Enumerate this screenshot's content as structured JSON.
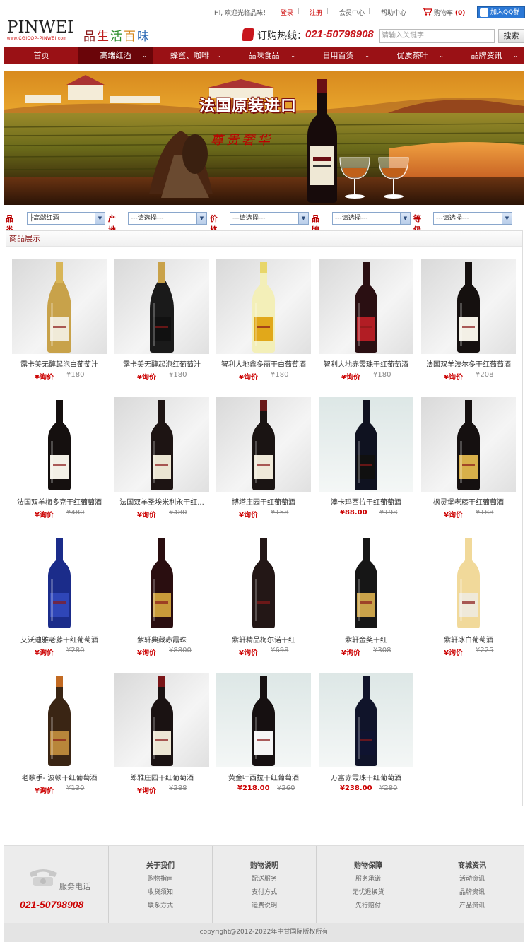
{
  "top_bar": {
    "greeting": "Hi, 欢迎光临品味！",
    "login": "登录",
    "register": "注册",
    "member_center": "会员中心",
    "help_center": "帮助中心",
    "cart_label": "购物车",
    "cart_count": "(0)",
    "qq_join": "加入QQ群"
  },
  "header": {
    "logo_text": "PINWEI",
    "logo_url_text": "www.CGICOP-PINWEI.com",
    "slogan": [
      "品",
      "生",
      "活",
      "百",
      "味"
    ],
    "hotline_label": "订购热线：",
    "hotline_number": "021-50798908",
    "search_placeholder": "请输入关键字",
    "search_button": "搜索"
  },
  "nav": {
    "items": [
      {
        "label": "首页",
        "has_menu": false
      },
      {
        "label": "高端红酒",
        "has_menu": true
      },
      {
        "label": "蜂蜜、咖啡",
        "has_menu": true
      },
      {
        "label": "品味食品",
        "has_menu": true
      },
      {
        "label": "日用百货",
        "has_menu": true
      },
      {
        "label": "优质茶叶",
        "has_menu": true
      },
      {
        "label": "品牌资讯",
        "has_menu": true
      }
    ]
  },
  "banner": {
    "title": "法国原装进口",
    "subtitle": "尊贵奢华"
  },
  "filters": [
    {
      "label": "品类",
      "value": "├高端红酒"
    },
    {
      "label": "产地",
      "value": "---请选择---"
    },
    {
      "label": "价格",
      "value": "---请选择---"
    },
    {
      "label": "品牌",
      "value": "---请选择---"
    },
    {
      "label": "等级",
      "value": "---请选择---"
    }
  ],
  "products_section": {
    "title": "商品展示",
    "items": [
      {
        "name": "露卡美无醇起泡白葡萄汁",
        "price": "¥询价",
        "old_price": "¥180",
        "bottle": "#c8a24a",
        "neck": "#d8b557",
        "label": "#f0ead8",
        "bg": "grey"
      },
      {
        "name": "露卡美无醇起泡红葡萄汁",
        "price": "¥询价",
        "old_price": "¥180",
        "bottle": "#1a1a1a",
        "neck": "#c9a24a",
        "label": "#111",
        "bg": "grey"
      },
      {
        "name": "智利大地鑫多丽干白葡萄酒",
        "price": "¥询价",
        "old_price": "¥180",
        "bottle": "#f3efb8",
        "neck": "#e8d66a",
        "label": "#e1a81a",
        "bg": "grey"
      },
      {
        "name": "智利大地赤霞珠干红葡萄酒",
        "price": "¥询价",
        "old_price": "¥180",
        "bottle": "#2a0f12",
        "neck": "#2a0f12",
        "label": "#b21d24",
        "bg": "grey"
      },
      {
        "name": "法国双羊波尔多干红葡萄酒",
        "price": "¥询价",
        "old_price": "¥208",
        "bottle": "#15100f",
        "neck": "#15100f",
        "label": "#f3f0e6",
        "bg": "grey"
      },
      {
        "name": "法国双羊梅多克干红葡萄酒",
        "price": "¥询价",
        "old_price": "¥480",
        "bottle": "#15100f",
        "neck": "#15100f",
        "label": "#f3f0e6",
        "bg": "white"
      },
      {
        "name": "法国双羊圣埃米利永干红...",
        "price": "¥询价",
        "old_price": "¥480",
        "bottle": "#1d1413",
        "neck": "#1d1413",
        "label": "#ebe5d2",
        "bg": "grey"
      },
      {
        "name": "博塔庄园干红葡萄酒",
        "price": "¥询价",
        "old_price": "¥158",
        "bottle": "#1a1413",
        "neck": "#6b1a1a",
        "label": "#efe9d9",
        "bg": "grey"
      },
      {
        "name": "澳卡玛西拉干红葡萄酒",
        "price": "¥88.00",
        "old_price": "¥198",
        "bottle": "#0f1220",
        "neck": "#0f1220",
        "label": "#101010",
        "bg": "sky"
      },
      {
        "name": "枫灵堡老藤干红葡萄酒",
        "price": "¥询价",
        "old_price": "¥188",
        "bottle": "#151010",
        "neck": "#151010",
        "label": "#d8b04a",
        "bg": "grey"
      },
      {
        "name": "艾沃迪雅老藤干红葡萄酒",
        "price": "¥询价",
        "old_price": "¥280",
        "bottle": "#1b2c8a",
        "neck": "#1b2c8a",
        "label": "#2f46b8",
        "bg": "white"
      },
      {
        "name": "紫轩典藏赤霞珠",
        "price": "¥询价",
        "old_price": "¥8800",
        "bottle": "#2a0e10",
        "neck": "#2a0e10",
        "label": "#c89a3a",
        "bg": "white"
      },
      {
        "name": "紫轩精品梅尔诺干红",
        "price": "¥询价",
        "old_price": "¥698",
        "bottle": "#231716",
        "neck": "#231716",
        "label": "#231716",
        "bg": "white"
      },
      {
        "name": "紫轩金奖干红",
        "price": "¥询价",
        "old_price": "¥308",
        "bottle": "#161616",
        "neck": "#161616",
        "label": "#c9a24a",
        "bg": "white"
      },
      {
        "name": "紫轩冰白葡萄酒",
        "price": "¥询价",
        "old_price": "¥225",
        "bottle": "#f1d99a",
        "neck": "#f1d99a",
        "label": "#efe9d9",
        "bg": "white"
      },
      {
        "name": "老歌手- 波顿干红葡萄酒",
        "price": "¥询价",
        "old_price": "¥130",
        "bottle": "#3a2514",
        "neck": "#c26a22",
        "label": "#b8863a",
        "bg": "white"
      },
      {
        "name": "郎雅庄园干红葡萄酒",
        "price": "¥询价",
        "old_price": "¥288",
        "bottle": "#1a1212",
        "neck": "#7a1518",
        "label": "#ece6d4",
        "bg": "grey"
      },
      {
        "name": "黄金叶西拉干红葡萄酒",
        "price": "¥218.00",
        "old_price": "¥260",
        "bottle": "#161011",
        "neck": "#161011",
        "label": "#f5f5f5",
        "bg": "sky"
      },
      {
        "name": "万富赤霞珠干红葡萄酒",
        "price": "¥238.00",
        "old_price": "¥280",
        "bottle": "#10142a",
        "neck": "#10142a",
        "label": "#0f1330",
        "bg": "sky"
      }
    ]
  },
  "footer": {
    "service_label": "服务电话",
    "service_number": "021-50798908",
    "columns": [
      {
        "title": "关于我们",
        "links": [
          "购物指南",
          "收货须知",
          "联系方式"
        ]
      },
      {
        "title": "购物说明",
        "links": [
          "配送服务",
          "支付方式",
          "运费说明"
        ]
      },
      {
        "title": "购物保障",
        "links": [
          "服务承诺",
          "无忧退换货",
          "先行赔付"
        ]
      },
      {
        "title": "商城资讯",
        "links": [
          "活动资讯",
          "品牌资讯",
          "产品资讯"
        ]
      }
    ],
    "copyright": "copyright@2012-2022年中甘国际版权所有"
  },
  "colors": {
    "brand_red": "#9a1115",
    "nav_active": "#6a0509",
    "price_red": "#cc0000"
  }
}
